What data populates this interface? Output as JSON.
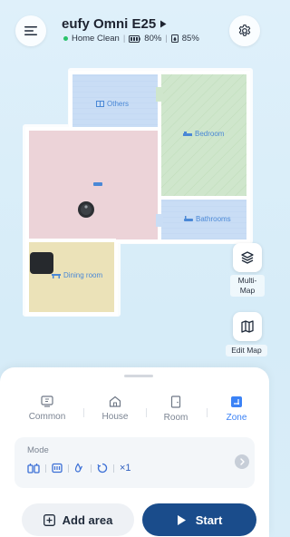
{
  "header": {
    "device_name": "eufy Omni E25",
    "status": "Home Clean",
    "battery": "80%",
    "water": "85%"
  },
  "map": {
    "rooms": [
      {
        "label": "Others",
        "color": "#c9ddf5"
      },
      {
        "label": "Bedroom",
        "color": "#cfe6cc"
      },
      {
        "label": "Bathrooms",
        "color": "#c9ddf5"
      },
      {
        "label": "",
        "color": "#ecd3d8"
      },
      {
        "label": "Dining room",
        "color": "#ebe2b8"
      }
    ]
  },
  "side_buttons": {
    "multi_map": "Multi-\nMap",
    "edit_map": "Edit Map"
  },
  "tabs": [
    {
      "label": "Common",
      "active": false
    },
    {
      "label": "House",
      "active": false
    },
    {
      "label": "Room",
      "active": false
    },
    {
      "label": "Zone",
      "active": true
    }
  ],
  "mode": {
    "title": "Mode",
    "count": "×1"
  },
  "actions": {
    "add_area": "Add area",
    "start": "Start"
  },
  "colors": {
    "accent": "#3b82f6",
    "start_button": "#1a4c8b"
  }
}
